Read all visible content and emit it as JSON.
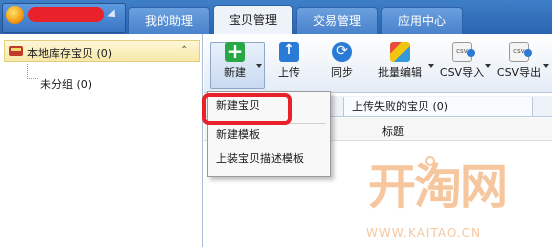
{
  "topbar": {
    "tabs": [
      {
        "label": "我的助理"
      },
      {
        "label": "宝贝管理"
      },
      {
        "label": "交易管理"
      },
      {
        "label": "应用中心"
      }
    ],
    "active_tab": "宝贝管理"
  },
  "left_panel": {
    "title": "本地库存宝贝 (0)",
    "tree_item": "未分组 (0)"
  },
  "toolbar": {
    "new_label": "新建",
    "upload_label": "上传",
    "sync_label": "同步",
    "batch_label": "批量编辑",
    "csv_import_label": "CSV导入",
    "csv_export_label": "CSV导出"
  },
  "subtabs": {
    "failed_label": "上传失败的宝贝 (0)"
  },
  "table": {
    "title_column": "标题"
  },
  "menu": {
    "items": [
      {
        "label": "新建宝贝"
      },
      {
        "label": "新建模板"
      },
      {
        "label": "上装宝贝描述模板"
      }
    ]
  },
  "watermark": {
    "logo_text": "开淘网",
    "url": "WWW.KAITAO.CN"
  },
  "colors": {
    "accent": "#2a64b0",
    "highlight": "#e8212b",
    "watermark": "#f6c79e"
  }
}
